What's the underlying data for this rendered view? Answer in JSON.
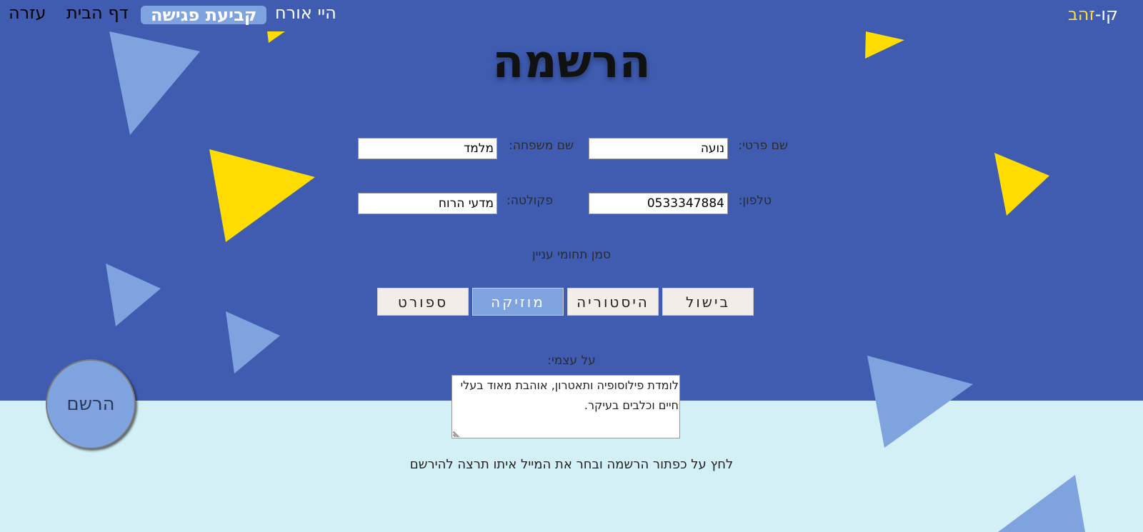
{
  "brand": {
    "prefix": "קו-",
    "highlight": "זהב"
  },
  "nav": {
    "help": "עזרה",
    "home": "דף הבית",
    "schedule_meeting": "קביעת פגישה",
    "greeting": "היי אורח"
  },
  "page": {
    "title": "הרשמה"
  },
  "form": {
    "first_name_label": "שם פרטי:",
    "first_name_value": "נועה",
    "last_name_label": "שם משפחה:",
    "last_name_value": "מלמד",
    "phone_label": "טלפון:",
    "phone_value": "0533347884",
    "faculty_label": "פקולטה:",
    "faculty_value": "מדעי הרוח"
  },
  "interests": {
    "label": "סמן תחומי עניין",
    "options": [
      {
        "label": "בישול",
        "selected": false
      },
      {
        "label": "היסטוריה",
        "selected": false
      },
      {
        "label": "מוזיקה",
        "selected": true
      },
      {
        "label": "ספורט",
        "selected": false
      }
    ]
  },
  "about": {
    "label": "על עצמי:",
    "value": "לומדת פילוסופיה ותאטרון, אוהבת מאוד בעלי חיים וכלבים בעיקר."
  },
  "hint": "לחץ על כפתור הרשמה ובחר את המייל איתו תרצה להירשם",
  "register_button": "הרשם",
  "colors": {
    "primary_blue": "#3f5cb1",
    "light_blue": "#7fa3de",
    "yellow": "#ffdd00",
    "background_light": "#d2f0f6"
  }
}
